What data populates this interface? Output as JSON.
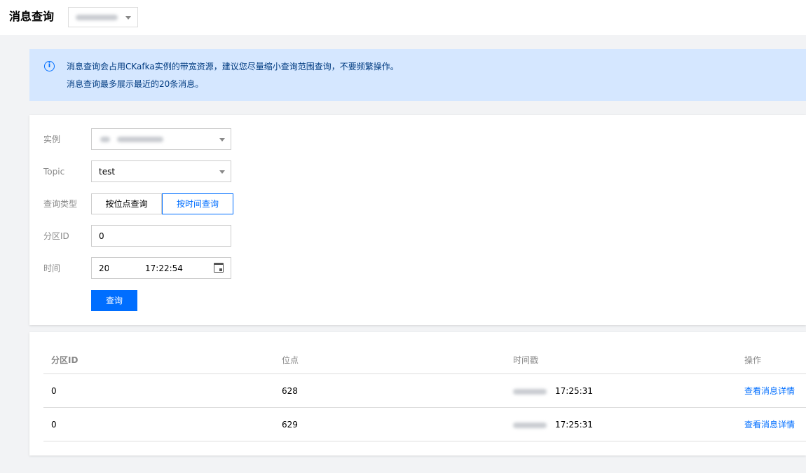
{
  "header": {
    "title": "消息查询",
    "region_select_value": ""
  },
  "alert": {
    "icon": "info-icon",
    "line1": "消息查询会占用CKafka实例的带宽资源，建议您尽量缩小查询范围查询，不要频繁操作。",
    "line2": "消息查询最多展示最近的20条消息。"
  },
  "form": {
    "instance_label": "实例",
    "instance_value": "",
    "topic_label": "Topic",
    "topic_value": "test",
    "query_type_label": "查询类型",
    "query_type_options": [
      "按位点查询",
      "按时间查询"
    ],
    "query_type_selected": "按时间查询",
    "partition_label": "分区ID",
    "partition_value": "0",
    "time_label": "时间",
    "time_prefix": "20",
    "time_value": "17:22:54",
    "query_button": "查询"
  },
  "table": {
    "columns": [
      "分区ID",
      "位点",
      "时间戳",
      "操作"
    ],
    "rows": [
      {
        "partition": "0",
        "offset": "628",
        "time": "17:25:31",
        "action": "查看消息详情"
      },
      {
        "partition": "0",
        "offset": "629",
        "time": "17:25:31",
        "action": "查看消息详情"
      }
    ]
  },
  "colors": {
    "accent": "#006eff",
    "alert_bg": "#d5e7ff",
    "page_bg": "#f2f3f5"
  }
}
